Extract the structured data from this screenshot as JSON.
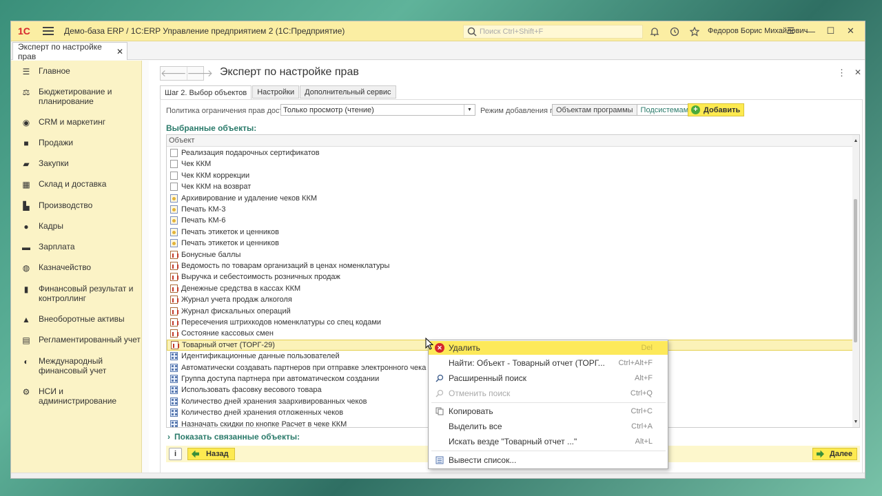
{
  "app": {
    "logo": "1С",
    "title": "Демо-база ERP / 1С:ERP Управление предприятием 2  (1С:Предприятие)",
    "search_placeholder": "Поиск Ctrl+Shift+F",
    "user": "Федоров Борис Михайлович",
    "colors": {
      "titlebar": "#fbeea3",
      "sidebar": "#fbf3c6",
      "accent": "#2a7a6a",
      "button": "#fdea50"
    }
  },
  "tabs": [
    {
      "label": "Эксперт по настройке прав",
      "close": "✕"
    }
  ],
  "sidebar": {
    "items": [
      {
        "label": "Главное",
        "icon": "menu-icon"
      },
      {
        "label": "Бюджетирование и планирование",
        "icon": "budget-icon"
      },
      {
        "label": "CRM и маркетинг",
        "icon": "crm-icon"
      },
      {
        "label": "Продажи",
        "icon": "bag-icon"
      },
      {
        "label": "Закупки",
        "icon": "cart-icon"
      },
      {
        "label": "Склад и доставка",
        "icon": "warehouse-icon"
      },
      {
        "label": "Производство",
        "icon": "factory-icon"
      },
      {
        "label": "Кадры",
        "icon": "person-icon"
      },
      {
        "label": "Зарплата",
        "icon": "wallet-icon"
      },
      {
        "label": "Казначейство",
        "icon": "treasury-icon"
      },
      {
        "label": "Финансовый результат и контроллинг",
        "icon": "chart-icon"
      },
      {
        "label": "Внеоборотные активы",
        "icon": "car-icon"
      },
      {
        "label": "Регламентированный учет",
        "icon": "document-icon"
      },
      {
        "label": "Международный финансовый учет",
        "icon": "globe-icon"
      },
      {
        "label": "НСИ и администрирование",
        "icon": "gear-icon"
      }
    ]
  },
  "form": {
    "title": "Эксперт по настройке прав",
    "tabs": [
      "Шаг 2. Выбор объектов",
      "Настройки",
      "Дополнительный сервис"
    ],
    "policy_label": "Политика ограничения прав доступа:",
    "policy_value": "Только просмотр (чтение)",
    "mode_label": "Режим добавления по:",
    "mode_options": [
      "Объектам программы",
      "Подсистемам"
    ],
    "add_button": "Добавить",
    "section_title": "Выбранные объекты:",
    "grid_header": "Объект",
    "rows": [
      {
        "label": "Реализация подарочных сертификатов",
        "type": "doc"
      },
      {
        "label": "Чек ККМ",
        "type": "doc"
      },
      {
        "label": "Чек ККМ коррекции",
        "type": "doc"
      },
      {
        "label": "Чек ККМ на возврат",
        "type": "doc"
      },
      {
        "label": "Архивирование и удаление чеков ККМ",
        "type": "proc"
      },
      {
        "label": "Печать КМ-3",
        "type": "proc"
      },
      {
        "label": "Печать КМ-6",
        "type": "proc"
      },
      {
        "label": "Печать этикеток и ценников",
        "type": "proc"
      },
      {
        "label": "Печать этикеток и ценников",
        "type": "proc"
      },
      {
        "label": "Бонусные баллы",
        "type": "report"
      },
      {
        "label": "Ведомость по товарам организаций в ценах номенклатуры",
        "type": "report"
      },
      {
        "label": "Выручка и себестоимость розничных продаж",
        "type": "report"
      },
      {
        "label": "Денежные средства в кассах ККМ",
        "type": "report"
      },
      {
        "label": "Журнал учета продаж алкоголя",
        "type": "report"
      },
      {
        "label": "Журнал фискальных операций",
        "type": "report"
      },
      {
        "label": "Пересечения штрихкодов номенклатуры со спец кодами",
        "type": "report"
      },
      {
        "label": "Состояние кассовых смен",
        "type": "report"
      },
      {
        "label": "Товарный отчет (ТОРГ-29)",
        "type": "report"
      },
      {
        "label": "Идентификационные данные пользователей",
        "type": "setting"
      },
      {
        "label": "Автоматически создавать партнеров при отправке электронного чека покупателю",
        "type": "setting"
      },
      {
        "label": "Группа доступа партнера при автоматическом создании",
        "type": "setting"
      },
      {
        "label": "Использовать фасовку весового товара",
        "type": "setting"
      },
      {
        "label": "Количество дней хранения заархивированных чеков",
        "type": "setting"
      },
      {
        "label": "Количество дней хранения отложенных чеков",
        "type": "setting"
      },
      {
        "label": "Назначать скидки по кнопке Расчет в чеке ККМ",
        "type": "setting"
      }
    ],
    "selected_row": 17,
    "linked_objects": "Показать связанные объекты:",
    "back_button": "Назад",
    "next_button": "Далее",
    "info": "i"
  },
  "context_menu": {
    "items": [
      {
        "label": "Удалить",
        "key": "Del",
        "icon": "delete-icon",
        "highlight": true
      },
      {
        "label": "Найти: Объект - Товарный отчет (ТОРГ...",
        "key": "Ctrl+Alt+F",
        "icon": ""
      },
      {
        "label": "Расширенный поиск",
        "key": "Alt+F",
        "icon": "search-icon"
      },
      {
        "label": "Отменить поиск",
        "key": "Ctrl+Q",
        "icon": "cancel-search-icon",
        "disabled": true
      },
      {
        "label": "Копировать",
        "key": "Ctrl+C",
        "icon": "copy-icon"
      },
      {
        "label": "Выделить все",
        "key": "Ctrl+A",
        "icon": ""
      },
      {
        "label": "Искать везде \"Товарный отчет ...\"",
        "key": "Alt+L",
        "icon": ""
      },
      {
        "label": "Вывести список...",
        "key": "",
        "icon": "list-icon"
      }
    ]
  }
}
